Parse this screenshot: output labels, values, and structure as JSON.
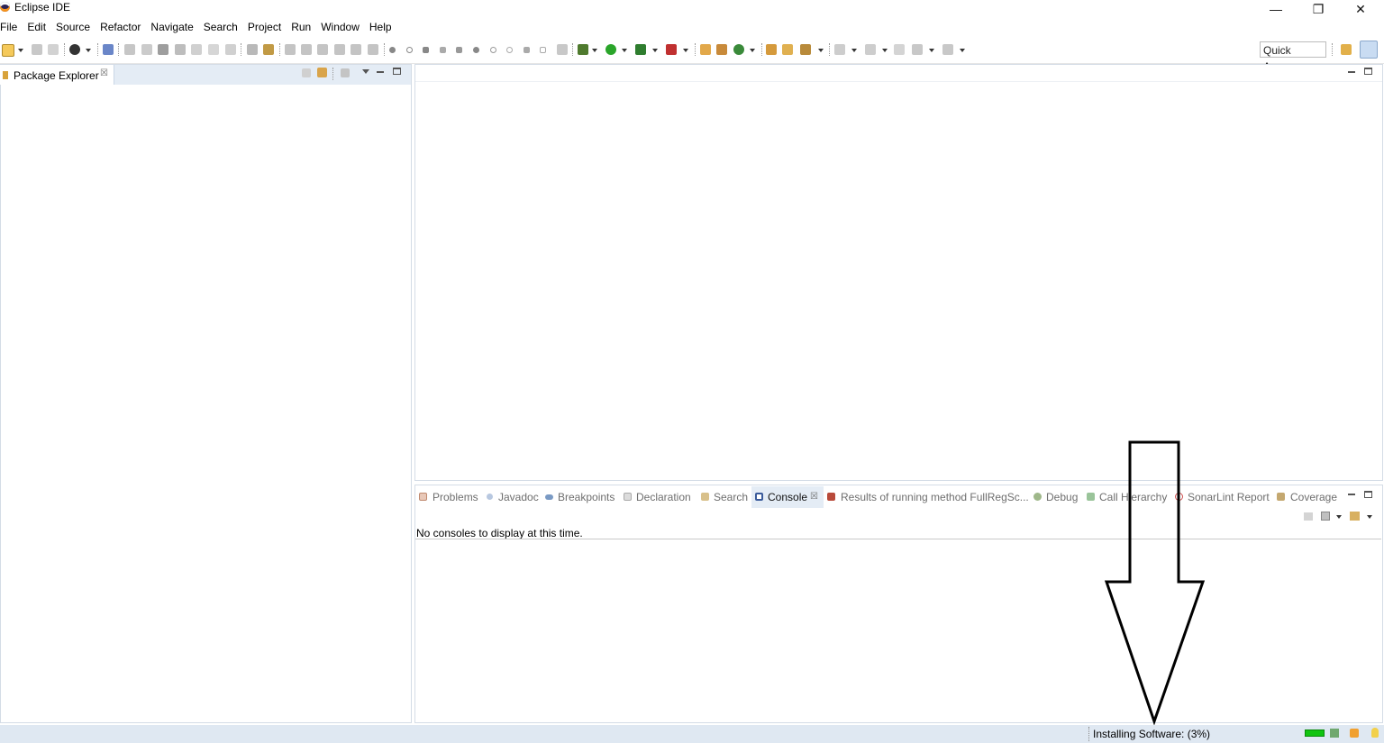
{
  "window": {
    "title": "Eclipse IDE",
    "minimize_glyph": "—",
    "restore_glyph": "❐",
    "close_glyph": "✕"
  },
  "menu": [
    "File",
    "Edit",
    "Source",
    "Refactor",
    "Navigate",
    "Search",
    "Project",
    "Run",
    "Window",
    "Help"
  ],
  "toolbar": {
    "quick_access_label": "Quick Access"
  },
  "left_view": {
    "tab_label": "Package Explorer",
    "close_glyph": "☒"
  },
  "bottom_view": {
    "tabs": [
      {
        "label": "Problems",
        "icon": "problems-icon"
      },
      {
        "label": "Javadoc",
        "icon": "javadoc-icon"
      },
      {
        "label": "Breakpoints",
        "icon": "breakpoints-icon"
      },
      {
        "label": "Declaration",
        "icon": "declaration-icon"
      },
      {
        "label": "Search",
        "icon": "search-icon"
      },
      {
        "label": "Console",
        "icon": "console-icon",
        "active": true
      },
      {
        "label": "Results of running method FullRegSc...",
        "icon": "junit-icon"
      },
      {
        "label": "Debug",
        "icon": "debug-icon"
      },
      {
        "label": "Call Hierarchy",
        "icon": "call-hierarchy-icon"
      },
      {
        "label": "SonarLint Report",
        "icon": "sonarlint-icon"
      },
      {
        "label": "Coverage",
        "icon": "coverage-icon"
      }
    ],
    "console_close_glyph": "☒",
    "console_message": "No consoles to display at this time."
  },
  "status": {
    "text": "Installing Software: (3%)",
    "progress_percent": 3
  },
  "colors": {
    "tab_area": "#e4ecf5",
    "status_bar": "#dfe8f2",
    "progress": "#11c411"
  }
}
